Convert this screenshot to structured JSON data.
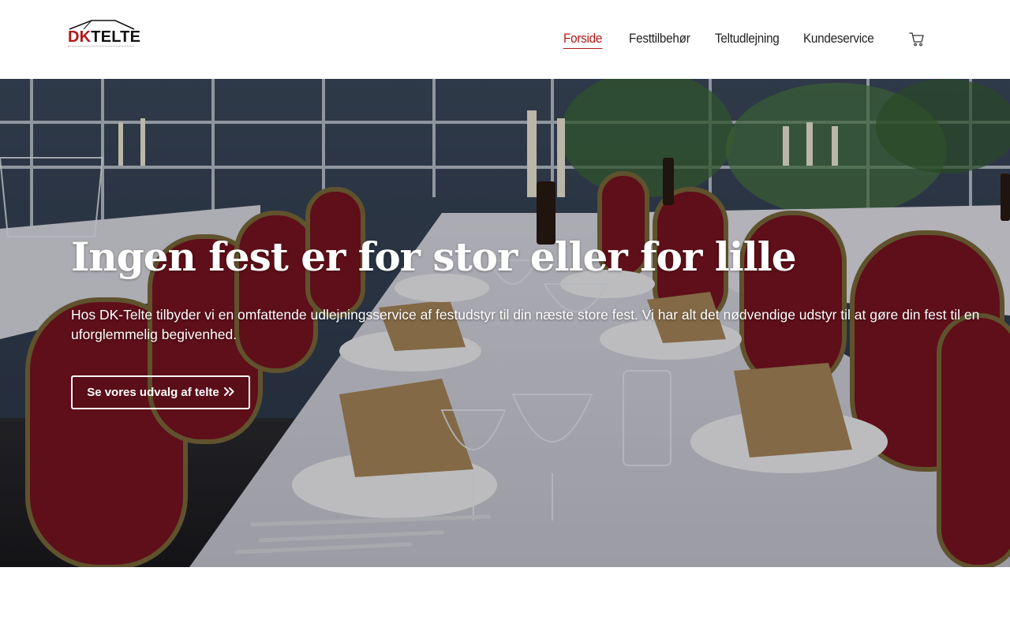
{
  "brand": {
    "logo_dk": "DK",
    "logo_telte": "TELTE",
    "accent_color": "#b01818"
  },
  "nav": {
    "items": [
      {
        "label": "Forside",
        "active": true
      },
      {
        "label": "Festtilbehør",
        "active": false
      },
      {
        "label": "Teltudlejning",
        "active": false
      },
      {
        "label": "Kundeservice",
        "active": false
      }
    ],
    "cart_icon": "shopping-cart-icon"
  },
  "hero": {
    "title": "Ingen fest er for stor eller for lille",
    "text": "Hos DK-Telte tilbyder vi en omfattende udlejningsservice af festudstyr til din næste store fest. Vi har alt det nødvendige udstyr til at gøre din fest til en uforglemmelig begivenhed.",
    "button_label": "Se vores udvalg af telte",
    "button_icon": "double-chevron-right-icon",
    "background": "banquet-table-photo"
  }
}
